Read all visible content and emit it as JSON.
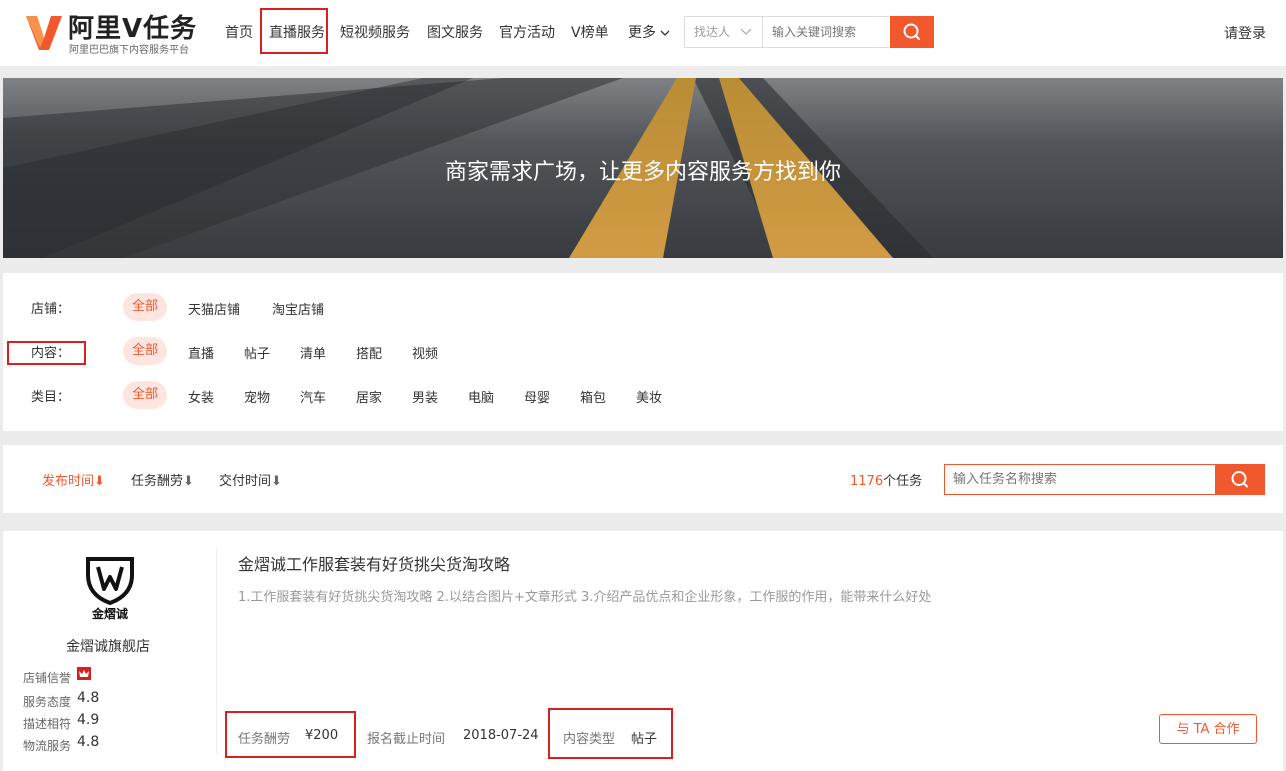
{
  "colors": {
    "accent": "#f2582d",
    "highlight_box": "#d81e1e"
  },
  "header": {
    "logo_title": "阿里V任务",
    "logo_subtitle": "阿里巴巴旗下内容服务平台",
    "nav": [
      "首页",
      "直播服务",
      "短视频服务",
      "图文服务",
      "官方活动",
      "V榜单",
      "更多"
    ],
    "search_type": "找达人",
    "search_placeholder": "输入关键词搜索",
    "login": "请登录"
  },
  "banner": {
    "text": "商家需求广场，让更多内容服务方找到你"
  },
  "filters": {
    "shop": {
      "label": "店铺：",
      "options": [
        "全部",
        "天猫店铺",
        "淘宝店铺"
      ],
      "selected": "全部"
    },
    "content": {
      "label": "内容：",
      "options": [
        "全部",
        "直播",
        "帖子",
        "清单",
        "搭配",
        "视频"
      ],
      "selected": "全部"
    },
    "category": {
      "label": "类目：",
      "options": [
        "全部",
        "女装",
        "宠物",
        "汽车",
        "居家",
        "男装",
        "电脑",
        "母婴",
        "箱包",
        "美妆"
      ],
      "selected": "全部"
    }
  },
  "sortbar": {
    "sorts": [
      "发布时间",
      "任务酬劳",
      "交付时间"
    ],
    "active_sort": "发布时间",
    "arrow": "⬇",
    "task_count": "1176",
    "task_count_suffix": "个任务",
    "search_placeholder": "输入任务名称搜索"
  },
  "task": {
    "store_logo_text": "金熠诚",
    "store_name": "金熠诚旗舰店",
    "credit_label": "店铺信誉",
    "metrics": [
      {
        "label": "服务态度",
        "value": "4.8"
      },
      {
        "label": "描述相符",
        "value": "4.9"
      },
      {
        "label": "物流服务",
        "value": "4.8"
      }
    ],
    "title": "金熠诚工作服套装有好货挑尖货淘攻略",
    "description": "1.工作服套装有好货挑尖货淘攻略 2.以结合图片+文章形式 3.介绍产品优点和企业形象，工作服的作用，能带来什么好处",
    "reward_label": "任务酬劳",
    "reward_value": "¥200",
    "deadline_label": "报名截止时间",
    "deadline_value": "2018-07-24",
    "content_type_label": "内容类型",
    "content_type_value": "帖子",
    "cta": "与 TA 合作"
  }
}
